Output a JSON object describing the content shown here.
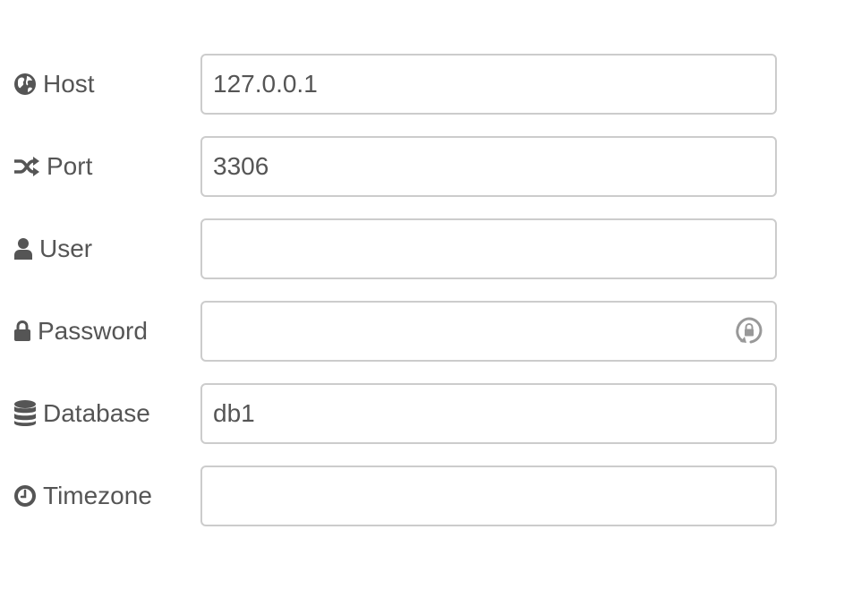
{
  "form": {
    "host": {
      "label": "Host",
      "icon": "globe-icon",
      "value": "127.0.0.1",
      "placeholder": ""
    },
    "port": {
      "label": "Port",
      "icon": "shuffle-icon",
      "value": "3306",
      "placeholder": ""
    },
    "user": {
      "label": "User",
      "icon": "user-icon",
      "value": "",
      "placeholder": ""
    },
    "password": {
      "label": "Password",
      "icon": "lock-icon",
      "value": "",
      "placeholder": "",
      "toggle_icon": "password-toggle-icon"
    },
    "database": {
      "label": "Database",
      "icon": "database-icon",
      "value": "db1",
      "placeholder": ""
    },
    "timezone": {
      "label": "Timezone",
      "icon": "clock-icon",
      "value": "",
      "placeholder": ""
    }
  },
  "colors": {
    "text": "#555555",
    "border": "#cccccc",
    "background": "#ffffff",
    "toggle_icon": "#999999"
  }
}
